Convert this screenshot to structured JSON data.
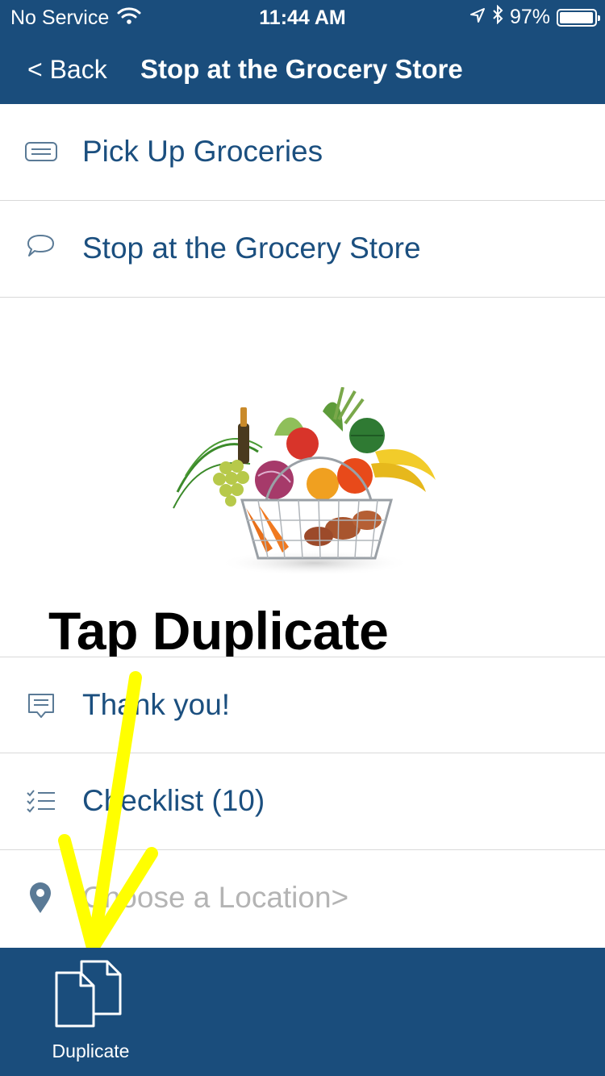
{
  "status_bar": {
    "carrier": "No Service",
    "time": "11:44 AM",
    "battery_percent": "97%",
    "battery_level": 0.97,
    "icons": [
      "wifi-icon",
      "location-arrow-icon",
      "bluetooth-icon",
      "battery-icon"
    ]
  },
  "nav": {
    "back_label": "< Back",
    "title": "Stop at the Grocery Store"
  },
  "rows": {
    "title": {
      "icon": "text-field-icon",
      "label": "Pick Up Groceries"
    },
    "message": {
      "icon": "speech-bubble-icon",
      "label": "Stop at the Grocery Store"
    },
    "note": {
      "icon": "note-icon",
      "label": "Thank you!"
    },
    "checklist": {
      "icon": "checklist-icon",
      "label": "Checklist (10)"
    },
    "location": {
      "icon": "location-pin-icon",
      "label": "Choose a Location>"
    }
  },
  "image": {
    "subject": "grocery-basket-photo"
  },
  "overlay": {
    "text": "Tap Duplicate",
    "arrow_color": "#ffff00"
  },
  "toolbar": {
    "duplicate_label": "Duplicate",
    "duplicate_icon": "duplicate-icon"
  },
  "colors": {
    "bar": "#1a4d7c",
    "row_text": "#1b4f7f",
    "placeholder": "#b4b4b4",
    "divider": "#d9d9d9"
  }
}
